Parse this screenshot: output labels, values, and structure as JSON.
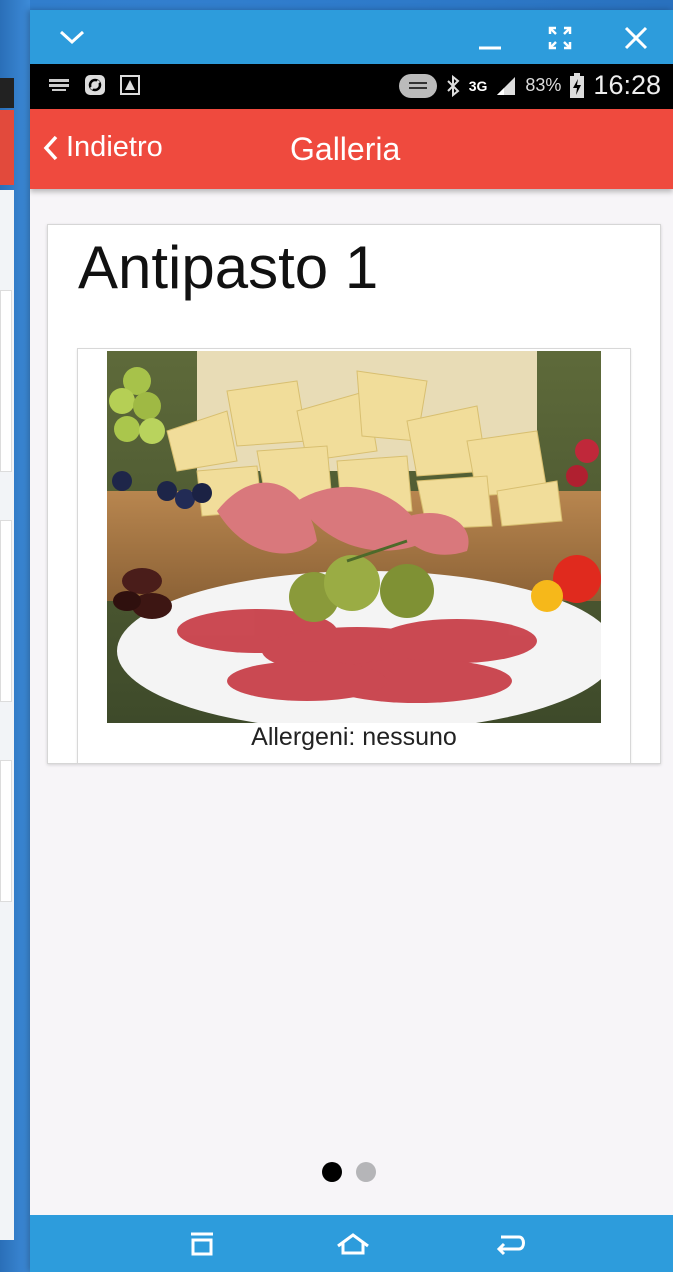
{
  "window": {
    "controls": {
      "collapse": "chevron-down-icon",
      "minimize": "minimize-icon",
      "maximize": "expand-icon",
      "close": "close-icon"
    }
  },
  "status_bar": {
    "network_type": "3G",
    "battery_percent": "83%",
    "time": "16:28"
  },
  "nav": {
    "back_label": "Indietro",
    "title": "Galleria"
  },
  "content": {
    "dish_title": "Antipasto 1",
    "image_alt": "Antipasto platter with cured meats, cheese, olives and tomatoes",
    "allergens": "Allergeni: nessuno"
  },
  "pager": {
    "pages": 2,
    "active_index": 0,
    "active_color": "#000000",
    "inactive_color": "#b5b5b8"
  },
  "colors": {
    "accent_red": "#ef4a3e",
    "chrome_blue": "#2d9cdc"
  }
}
